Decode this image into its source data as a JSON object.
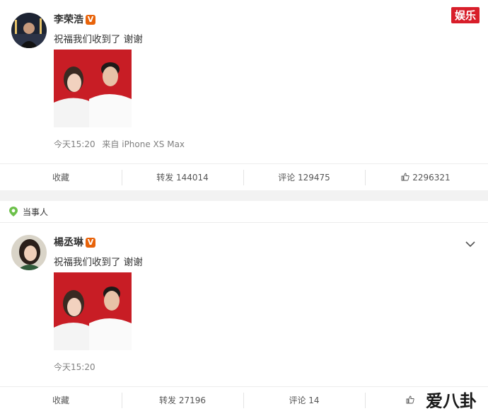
{
  "watermark": {
    "top_label": "娱乐",
    "bottom_label": "爱八卦"
  },
  "section_header": {
    "label": "当事人"
  },
  "posts": [
    {
      "author": "李荣浩",
      "verified_mark": "V",
      "text": "祝福我们收到了 谢谢",
      "timestamp": "今天15:20",
      "source": "来自 iPhone XS Max",
      "actions": {
        "favorite": "收藏",
        "repost": "转发 144014",
        "comment": "评论 129475",
        "like": "2296321"
      }
    },
    {
      "author": "楊丞琳",
      "verified_mark": "V",
      "text": "祝福我们收到了 谢谢",
      "timestamp": "今天15:20",
      "actions": {
        "favorite": "收藏",
        "repost": "转发 27196",
        "comment": "评论 14",
        "like": ""
      }
    }
  ],
  "colors": {
    "photo_background": "#c81d25",
    "verified_badge": "#e8630a",
    "section_icon": "#6cc04a"
  }
}
